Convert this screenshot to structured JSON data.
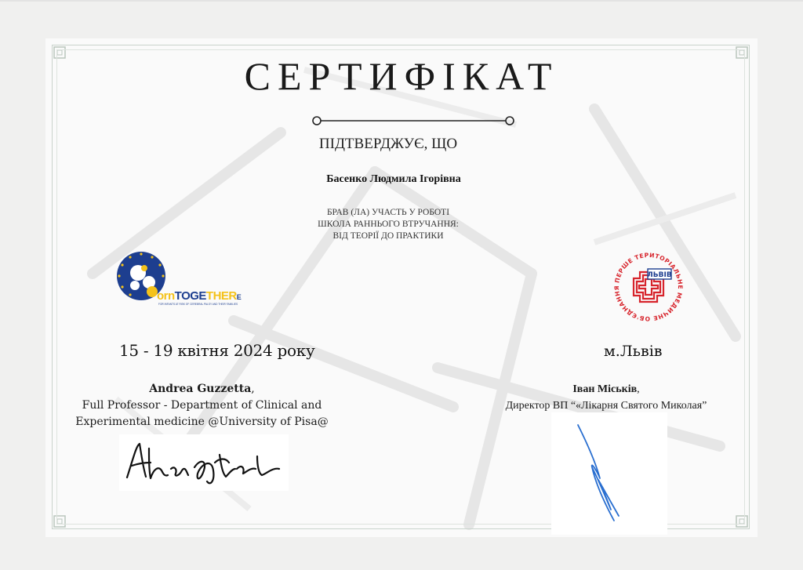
{
  "certificate": {
    "title": "СЕРТИФІКАТ",
    "confirms": "ПІДТВЕРДЖУЄ, ЩО",
    "recipient": "Басенко Людмила Ігорівна",
    "participation_lines": [
      "БРАВ (ЛА) УЧАСТЬ У РОБОТІ",
      "ШКОЛА РАННЬОГО ВТРУЧАННЯ:",
      "ВІД ТЕОРІЇ ДО ПРАКТИКИ"
    ],
    "dates": "15 - 19 квітня 2024 року",
    "city": "м.Львів"
  },
  "logos": {
    "left": {
      "wordmark_a": "orn",
      "wordmark_b": "TOGE",
      "wordmark_c": "THER",
      "wordmark_d": "E",
      "tagline": "FOR INFANTS AT RISK OF CEREBRAL PALSY AND THEIR FAMILIES"
    },
    "right": {
      "ring_text": "ПЕРШЕ ТЕРИТОРІАЛЬНЕ МЕДИЧНЕ ОБ'ЄДНАННЯ",
      "badge": "ЛЬВІВ"
    }
  },
  "signatories": [
    {
      "name": "Andrea Guzzetta",
      "name_suffix": ",",
      "role_line1": "Full Professor - Department of Clinical and",
      "role_line2": "Experimental medicine @University of Pisa@"
    },
    {
      "name": "Іван Міськів",
      "name_suffix": ",",
      "role_line1": "Директор ВП “«Лікарня Святого Миколая”"
    }
  ],
  "colors": {
    "logo_blue": "#1d3e8f",
    "logo_yellow": "#f4c21a",
    "logo_red": "#d7242c",
    "signature_blue": "#2a6fd0",
    "frame": "#c9d3cc"
  }
}
